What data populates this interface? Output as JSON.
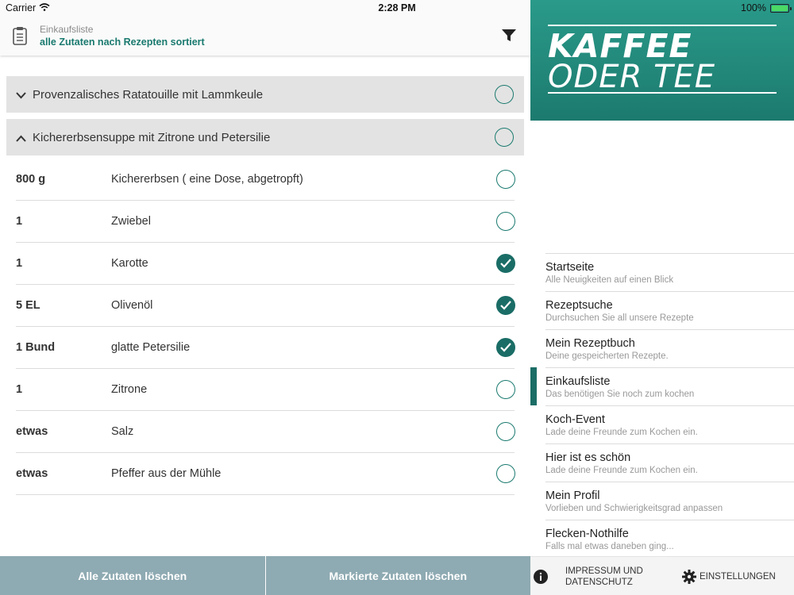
{
  "status": {
    "carrier": "Carrier",
    "time": "2:28 PM",
    "battery": "100%",
    "battery_fill": 1.0
  },
  "header": {
    "title": "Einkaufsliste",
    "subtitle": "alle Zutaten nach Rezepten sortiert"
  },
  "recipes": [
    {
      "title": "Provenzalisches Ratatouille mit Lammkeule",
      "expanded": false
    },
    {
      "title": "Kichererbsensuppe mit Zitrone und Petersilie",
      "expanded": true
    }
  ],
  "ingredients": [
    {
      "amount": "800 g",
      "name": "Kichererbsen ( eine Dose, abgetropft)",
      "checked": false
    },
    {
      "amount": "1",
      "name": "Zwiebel",
      "checked": false
    },
    {
      "amount": "1",
      "name": "Karotte",
      "checked": true
    },
    {
      "amount": "5 EL",
      "name": "Olivenöl",
      "checked": true
    },
    {
      "amount": "1 Bund",
      "name": "glatte Petersilie",
      "checked": true
    },
    {
      "amount": "1",
      "name": "Zitrone",
      "checked": false
    },
    {
      "amount": "etwas",
      "name": "Salz",
      "checked": false
    },
    {
      "amount": "etwas",
      "name": "Pfeffer aus der Mühle",
      "checked": false
    }
  ],
  "buttons": {
    "clear_all": "Alle Zutaten löschen",
    "clear_marked": "Markierte Zutaten löschen"
  },
  "brand": {
    "line1": "KAFFEE",
    "line2": "ODER TEE"
  },
  "menu": [
    {
      "title": "Startseite",
      "subtitle": "Alle Neuigkeiten auf einen Blick",
      "active": false
    },
    {
      "title": "Rezeptsuche",
      "subtitle": "Durchsuchen Sie all unsere Rezepte",
      "active": false
    },
    {
      "title": "Mein Rezeptbuch",
      "subtitle": "Deine gespeicherten Rezepte.",
      "active": false
    },
    {
      "title": "Einkaufsliste",
      "subtitle": "Das benötigen Sie noch zum kochen",
      "active": true
    },
    {
      "title": "Koch-Event",
      "subtitle": "Lade deine Freunde zum Kochen ein.",
      "active": false
    },
    {
      "title": "Hier ist es schön",
      "subtitle": "Lade deine Freunde zum Kochen ein.",
      "active": false
    },
    {
      "title": "Mein Profil",
      "subtitle": "Vorlieben und Schwierigkeitsgrad anpassen",
      "active": false
    },
    {
      "title": "Flecken-Nothilfe",
      "subtitle": "Falls mal etwas daneben ging...",
      "active": false
    }
  ],
  "footer": {
    "imprint": "IMPRESSUM UND DATENSCHUTZ",
    "settings": "EINSTELLUNGEN"
  },
  "colors": {
    "accent": "#1a6d66",
    "brand_bg": "#1c7a6e",
    "button_bar": "#8eaab2"
  }
}
